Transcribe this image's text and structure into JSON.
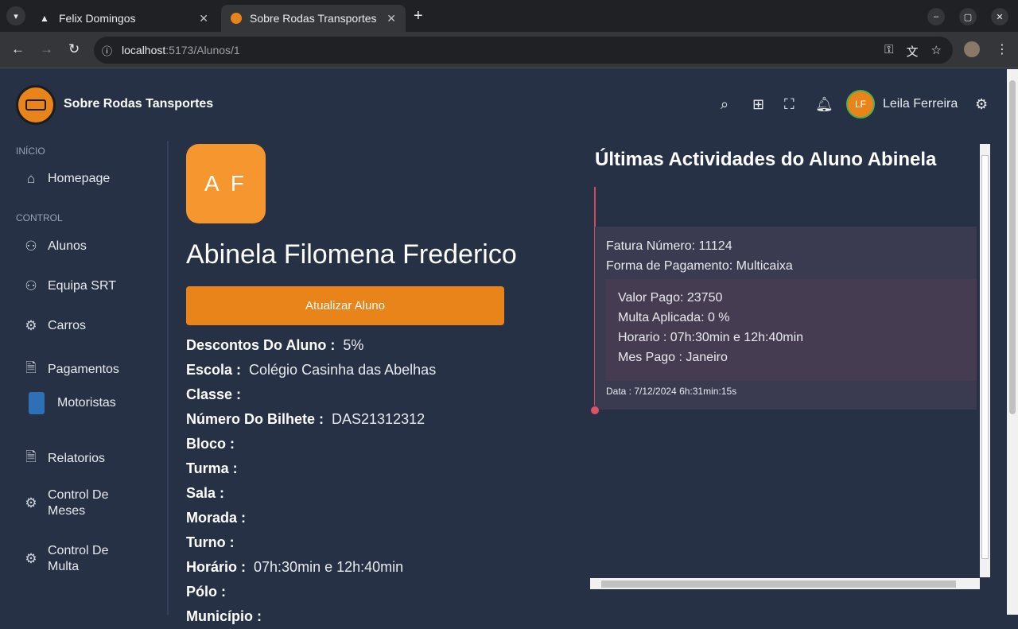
{
  "browser": {
    "tabs": [
      {
        "title": "Felix Domingos",
        "icon": "vercel-triangle-icon"
      },
      {
        "title": "Sobre Rodas Transportes",
        "icon": "site-favicon"
      }
    ],
    "url_host": "localhost",
    "url_path": ":5173/Alunos/1"
  },
  "header": {
    "brand": "Sobre Rodas Tansportes",
    "user_initials": "LF",
    "user_name": "Leila Ferreira"
  },
  "sidebar": {
    "section_inicio": "INÍCIO",
    "section_control": "CONTROL",
    "items": [
      {
        "label": "Homepage",
        "icon": "home-icon"
      },
      {
        "label": "Alunos",
        "icon": "users-icon"
      },
      {
        "label": "Equipa SRT",
        "icon": "users-icon"
      },
      {
        "label": "Carros",
        "icon": "gear-icon"
      },
      {
        "label": "Pagamentos",
        "icon": "document-icon"
      },
      {
        "label": "Motoristas",
        "icon": "phone-icon"
      },
      {
        "label": "Relatorios",
        "icon": "document-icon"
      },
      {
        "label": "Control De Meses",
        "icon": "gear-icon"
      },
      {
        "label": "Control De Multa",
        "icon": "gear-icon"
      }
    ]
  },
  "student": {
    "initials": "A F",
    "name": "Abinela Filomena Frederico",
    "update_button": "Atualizar Aluno",
    "fields": [
      {
        "label": "Descontos Do Aluno :",
        "value": "5%"
      },
      {
        "label": "Escola :",
        "value": "Colégio Casinha das Abelhas"
      },
      {
        "label": "Classe :",
        "value": ""
      },
      {
        "label": "Número Do Bilhete :",
        "value": "DAS21312312"
      },
      {
        "label": "Bloco :",
        "value": ""
      },
      {
        "label": "Turma :",
        "value": ""
      },
      {
        "label": "Sala :",
        "value": ""
      },
      {
        "label": "Morada :",
        "value": ""
      },
      {
        "label": "Turno :",
        "value": ""
      },
      {
        "label": "Horário :",
        "value": "07h:30min e 12h:40min"
      },
      {
        "label": "Pólo :",
        "value": ""
      },
      {
        "label": "Município :",
        "value": ""
      }
    ]
  },
  "activities": {
    "title": "Últimas Actividades do Aluno Abinela",
    "invoice": "Fatura Número: 11124",
    "payment_method": "Forma de Pagamento: Multicaixa",
    "amount_paid": "Valor Pago: 23750",
    "fine": "Multa Aplicada: 0 %",
    "schedule": "Horario : 07h:30min e 12h:40min",
    "month_paid": "Mes Pago : Janeiro",
    "date": "Data : 7/12/2024 6h:31min:15s"
  }
}
